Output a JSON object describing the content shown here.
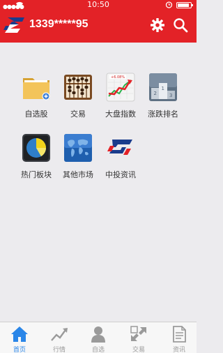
{
  "status_bar": {
    "time": "10:50",
    "battery_level": 0.9
  },
  "header": {
    "account": "1339*****95",
    "brand_color": "#e32227",
    "icons": [
      "logo-icon",
      "settings-gear-icon",
      "search-icon"
    ]
  },
  "menu": {
    "items": [
      {
        "label": "自选股",
        "icon": "folder-icon"
      },
      {
        "label": "交易",
        "icon": "abacus-icon"
      },
      {
        "label": "大盘指数",
        "icon": "rising-chart-icon"
      },
      {
        "label": "涨跌排名",
        "icon": "podium-ranking-icon"
      },
      {
        "label": "热门板块",
        "icon": "pie-chart-icon"
      },
      {
        "label": "其他市场",
        "icon": "world-map-icon"
      },
      {
        "label": "中投资讯",
        "icon": "brand-logo-icon"
      }
    ]
  },
  "tabbar": {
    "active_color": "#2a86e8",
    "tabs": [
      {
        "label": "首页",
        "icon": "home-icon",
        "active": true
      },
      {
        "label": "行情",
        "icon": "trend-line-icon",
        "active": false
      },
      {
        "label": "自选",
        "icon": "person-icon",
        "active": false
      },
      {
        "label": "交易",
        "icon": "exchange-arrows-icon",
        "active": false
      },
      {
        "label": "资讯",
        "icon": "document-icon",
        "active": false
      }
    ]
  }
}
